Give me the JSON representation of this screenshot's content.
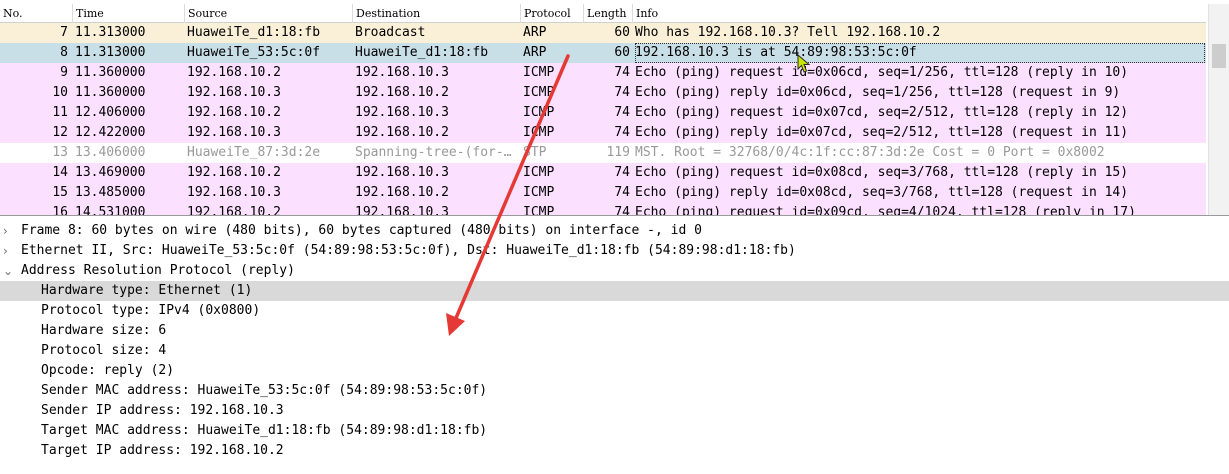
{
  "packet_list": {
    "columns": [
      "No.",
      "Time",
      "Source",
      "Destination",
      "Protocol",
      "Length",
      "Info"
    ],
    "rows": [
      {
        "no": "7",
        "time": "11.313000",
        "src": "HuaweiTe_d1:18:fb",
        "dst": "Broadcast",
        "proto": "ARP",
        "len": "60",
        "info": "Who has 192.168.10.3? Tell 192.168.10.2",
        "bg": "#faf0d7",
        "fg": "#000000"
      },
      {
        "no": "8",
        "time": "11.313000",
        "src": "HuaweiTe_53:5c:0f",
        "dst": "HuaweiTe_d1:18:fb",
        "proto": "ARP",
        "len": "60",
        "info": "192.168.10.3 is at 54:89:98:53:5c:0f",
        "bg": "#c9dfe8",
        "fg": "#000000",
        "selected": true
      },
      {
        "no": "9",
        "time": "11.360000",
        "src": "192.168.10.2",
        "dst": "192.168.10.3",
        "proto": "ICMP",
        "len": "74",
        "info": "Echo (ping) request  id=0x06cd, seq=1/256, ttl=128 (reply in 10)",
        "bg": "#fce0ff",
        "fg": "#000000"
      },
      {
        "no": "10",
        "time": "11.360000",
        "src": "192.168.10.3",
        "dst": "192.168.10.2",
        "proto": "ICMP",
        "len": "74",
        "info": "Echo (ping) reply    id=0x06cd, seq=1/256, ttl=128 (request in 9)",
        "bg": "#fce0ff",
        "fg": "#000000"
      },
      {
        "no": "11",
        "time": "12.406000",
        "src": "192.168.10.2",
        "dst": "192.168.10.3",
        "proto": "ICMP",
        "len": "74",
        "info": "Echo (ping) request  id=0x07cd, seq=2/512, ttl=128 (reply in 12)",
        "bg": "#fce0ff",
        "fg": "#000000"
      },
      {
        "no": "12",
        "time": "12.422000",
        "src": "192.168.10.3",
        "dst": "192.168.10.2",
        "proto": "ICMP",
        "len": "74",
        "info": "Echo (ping) reply    id=0x07cd, seq=2/512, ttl=128 (request in 11)",
        "bg": "#fce0ff",
        "fg": "#000000"
      },
      {
        "no": "13",
        "time": "13.406000",
        "src": "HuaweiTe_87:3d:2e",
        "dst": "Spanning-tree-(for-…",
        "proto": "STP",
        "len": "119",
        "info": "MST. Root = 32768/0/4c:1f:cc:87:3d:2e  Cost = 0  Port = 0x8002",
        "bg": "#ffffff",
        "fg": "#9a9a9a"
      },
      {
        "no": "14",
        "time": "13.469000",
        "src": "192.168.10.2",
        "dst": "192.168.10.3",
        "proto": "ICMP",
        "len": "74",
        "info": "Echo (ping) request  id=0x08cd, seq=3/768, ttl=128 (reply in 15)",
        "bg": "#fce0ff",
        "fg": "#000000"
      },
      {
        "no": "15",
        "time": "13.485000",
        "src": "192.168.10.3",
        "dst": "192.168.10.2",
        "proto": "ICMP",
        "len": "74",
        "info": "Echo (ping) reply    id=0x08cd, seq=3/768, ttl=128 (request in 14)",
        "bg": "#fce0ff",
        "fg": "#000000"
      },
      {
        "no": "16",
        "time": "14.531000",
        "src": "192.168.10.2",
        "dst": "192.168.10.3",
        "proto": "ICMP",
        "len": "74",
        "info": "Echo (ping) request  id=0x09cd, seq=4/1024, ttl=128 (reply in 17)",
        "bg": "#fce0ff",
        "fg": "#000000"
      }
    ]
  },
  "details": {
    "rows": [
      {
        "text": "Frame 8: 60 bytes on wire (480 bits), 60 bytes captured (480 bits) on interface -, id 0",
        "arrow": "›",
        "level": 0
      },
      {
        "text": "Ethernet II, Src: HuaweiTe_53:5c:0f (54:89:98:53:5c:0f), Dst: HuaweiTe_d1:18:fb (54:89:98:d1:18:fb)",
        "arrow": "›",
        "level": 0
      },
      {
        "text": "Address Resolution Protocol (reply)",
        "arrow": "⌄",
        "level": 0
      },
      {
        "text": "Hardware type: Ethernet (1)",
        "level": 1,
        "selected": true
      },
      {
        "text": "Protocol type: IPv4 (0x0800)",
        "level": 1
      },
      {
        "text": "Hardware size: 6",
        "level": 1
      },
      {
        "text": "Protocol size: 4",
        "level": 1
      },
      {
        "text": "Opcode: reply (2)",
        "level": 1
      },
      {
        "text": "Sender MAC address: HuaweiTe_53:5c:0f (54:89:98:53:5c:0f)",
        "level": 1
      },
      {
        "text": "Sender IP address: 192.168.10.3",
        "level": 1
      },
      {
        "text": "Target MAC address: HuaweiTe_d1:18:fb (54:89:98:d1:18:fb)",
        "level": 1
      },
      {
        "text": "Target IP address: 192.168.10.2",
        "level": 1
      }
    ]
  },
  "colors": {
    "arp_row": "#faf0d7",
    "selected_row": "#c9dfe8",
    "icmp_row": "#fce0ff",
    "annotation_arrow": "#e53935",
    "cursor": "#c8e600"
  },
  "icons": {
    "collapsed": "chevron-right-icon",
    "expanded": "chevron-down-icon",
    "pointer": "mouse-cursor-icon"
  }
}
